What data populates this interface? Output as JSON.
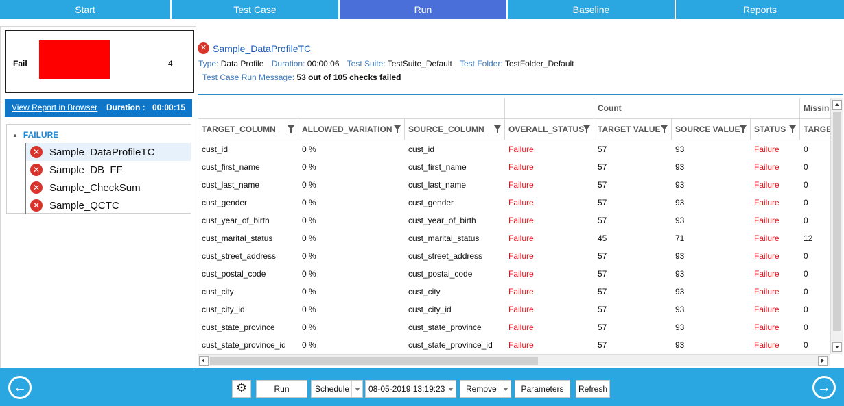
{
  "nav": {
    "tabs": [
      {
        "label": "Start"
      },
      {
        "label": "Test Case"
      },
      {
        "label": "Run"
      },
      {
        "label": "Baseline"
      },
      {
        "label": "Reports"
      }
    ],
    "active": "Run"
  },
  "summary": {
    "status_label": "Fail",
    "count": "4",
    "bar_color": "#ff0000"
  },
  "report": {
    "link_label": "View Report in Browser",
    "duration_label": "Duration :",
    "duration_value": "00:00:15"
  },
  "tree": {
    "group_label": "FAILURE",
    "items": [
      {
        "label": "Sample_DataProfileTC",
        "icon": "error-icon"
      },
      {
        "label": "Sample_DB_FF",
        "icon": "error-icon"
      },
      {
        "label": "Sample_CheckSum",
        "icon": "error-icon"
      },
      {
        "label": "Sample_QCTC",
        "icon": "error-icon"
      }
    ]
  },
  "test_case": {
    "name": "Sample_DataProfileTC",
    "type_label": "Type:",
    "type_value": "Data Profile",
    "duration_label": "Duration:",
    "duration_value": "00:00:06",
    "suite_label": "Test Suite:",
    "suite_value": "TestSuite_Default",
    "folder_label": "Test Folder:",
    "folder_value": "TestFolder_Default",
    "message_label": "Test Case Run Message:",
    "message_value": "53 out of 105 checks failed"
  },
  "grid": {
    "group_headers": [
      "Count",
      "Missing"
    ],
    "columns": [
      "TARGET_COLUMN",
      "ALLOWED_VARIATION",
      "SOURCE_COLUMN",
      "OVERALL_STATUS",
      "TARGET VALUE",
      "SOURCE VALUE",
      "STATUS",
      "TARGET"
    ],
    "rows": [
      [
        "cust_id",
        "0 %",
        "cust_id",
        "Failure",
        "57",
        "93",
        "Failure",
        "0"
      ],
      [
        "cust_first_name",
        "0 %",
        "cust_first_name",
        "Failure",
        "57",
        "93",
        "Failure",
        "0"
      ],
      [
        "cust_last_name",
        "0 %",
        "cust_last_name",
        "Failure",
        "57",
        "93",
        "Failure",
        "0"
      ],
      [
        "cust_gender",
        "0 %",
        "cust_gender",
        "Failure",
        "57",
        "93",
        "Failure",
        "0"
      ],
      [
        "cust_year_of_birth",
        "0 %",
        "cust_year_of_birth",
        "Failure",
        "57",
        "93",
        "Failure",
        "0"
      ],
      [
        "cust_marital_status",
        "0 %",
        "cust_marital_status",
        "Failure",
        "45",
        "71",
        "Failure",
        "12"
      ],
      [
        "cust_street_address",
        "0 %",
        "cust_street_address",
        "Failure",
        "57",
        "93",
        "Failure",
        "0"
      ],
      [
        "cust_postal_code",
        "0 %",
        "cust_postal_code",
        "Failure",
        "57",
        "93",
        "Failure",
        "0"
      ],
      [
        "cust_city",
        "0 %",
        "cust_city",
        "Failure",
        "57",
        "93",
        "Failure",
        "0"
      ],
      [
        "cust_city_id",
        "0 %",
        "cust_city_id",
        "Failure",
        "57",
        "93",
        "Failure",
        "0"
      ],
      [
        "cust_state_province",
        "0 %",
        "cust_state_province",
        "Failure",
        "57",
        "93",
        "Failure",
        "0"
      ],
      [
        "cust_state_province_id",
        "0 %",
        "cust_state_province_id",
        "Failure",
        "57",
        "93",
        "Failure",
        "0"
      ]
    ]
  },
  "toolbar": {
    "settings_icon": "gear-icon",
    "run_label": "Run",
    "schedule_label": "Schedule",
    "datetime_value": "08-05-2019 13:19:23",
    "remove_label": "Remove",
    "parameters_label": "Parameters",
    "refresh_label": "Refresh"
  },
  "colors": {
    "nav": "#2aa6e0",
    "nav_active": "#4a6fd8",
    "failure_text": "#e8141b",
    "report_bar": "#0f77c9"
  }
}
